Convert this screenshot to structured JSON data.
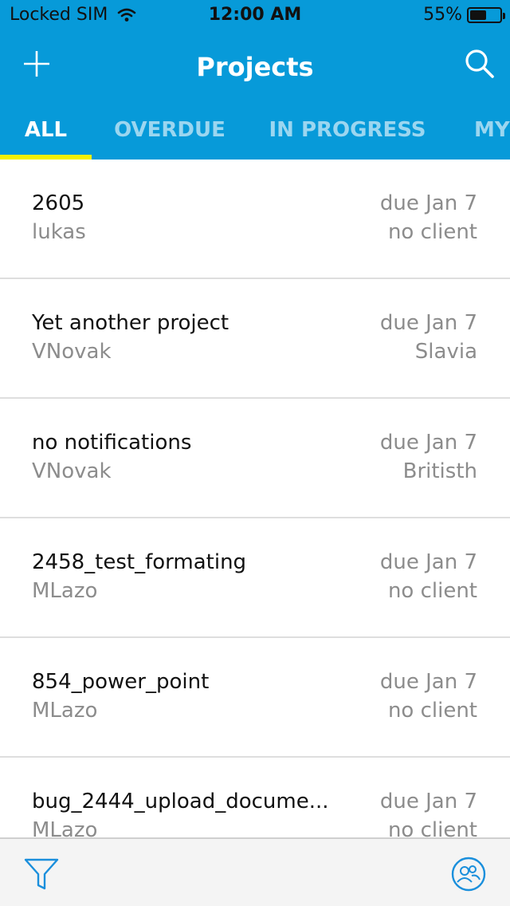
{
  "colors": {
    "brand": "#079ad9",
    "tab_indicator": "#f5f000",
    "accent_icon": "#1a8fdc"
  },
  "status_bar": {
    "carrier": "Locked SIM",
    "time": "12:00 AM",
    "battery": "55%",
    "battery_level": 0.55,
    "wifi_icon": "wifi-icon"
  },
  "navbar": {
    "title": "Projects",
    "add_icon": "plus-icon",
    "search_icon": "search-icon"
  },
  "tabs": [
    {
      "label": "ALL",
      "active": true
    },
    {
      "label": "OVERDUE",
      "active": false
    },
    {
      "label": "IN PROGRESS",
      "active": false
    },
    {
      "label": "MY",
      "active": false
    }
  ],
  "projects": [
    {
      "name": "2605",
      "owner": "lukas",
      "due": "due Jan 7",
      "client": "no client"
    },
    {
      "name": "Yet another project",
      "owner": "VNovak",
      "due": "due Jan 7",
      "client": "Slavia"
    },
    {
      "name": "no notifications",
      "owner": "VNovak",
      "due": "due Jan 7",
      "client": "Britisth"
    },
    {
      "name": "2458_test_formating",
      "owner": "MLazo",
      "due": "due Jan 7",
      "client": "no client"
    },
    {
      "name": "854_power_point",
      "owner": "MLazo",
      "due": "due Jan 7",
      "client": "no client"
    },
    {
      "name": "bug_2444_upload_docume...",
      "owner": "MLazo",
      "due": "due Jan 7",
      "client": "no client"
    }
  ],
  "bottom_bar": {
    "filter_icon": "filter-icon",
    "people_icon": "people-icon"
  }
}
